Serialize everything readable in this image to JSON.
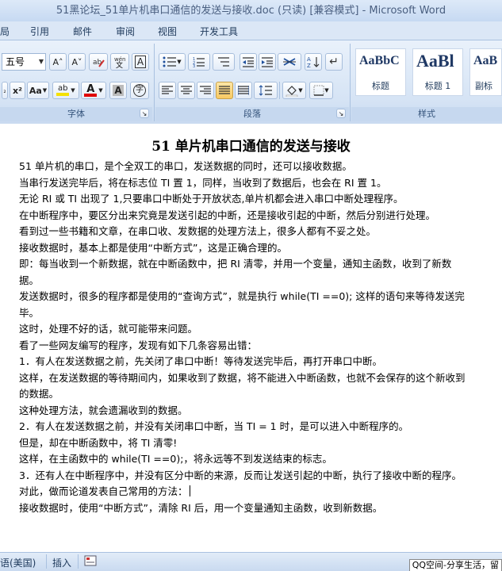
{
  "window": {
    "title": "51黑论坛_51单片机串口通信的发送与接收.doc (只读) [兼容模式] - Microsoft Word"
  },
  "menu": {
    "tabs": [
      "局",
      "引用",
      "邮件",
      "审阅",
      "视图",
      "开发工具"
    ]
  },
  "ribbon": {
    "font": {
      "size": "五号",
      "group_label": "字体",
      "grow_label": "A˄",
      "shrink_label": "A˅",
      "phonetic_label": "ab",
      "char_border_label": "A",
      "superscript_label": "x²",
      "case_label": "Aa",
      "highlight_label": "ab",
      "font_color_label": "A",
      "shading_label": "A",
      "enclose_label": "字",
      "highlight_color": "#f5e100",
      "font_color": "#e00000"
    },
    "paragraph": {
      "group_label": "段落"
    },
    "styles": {
      "group_label": "样式",
      "items": [
        {
          "sample": "AaBbC",
          "name": "标题"
        },
        {
          "sample": "AaBl",
          "name": "标题 1"
        },
        {
          "sample": "AaB",
          "name": "副标"
        }
      ]
    }
  },
  "document": {
    "title": "51 单片机串口通信的发送与接收",
    "paragraphs": [
      "51 单片机的串口，是个全双工的串口，发送数据的同时，还可以接收数据。",
      "当串行发送完毕后，将在标志位 TI 置 1，同样，当收到了数据后，也会在 RI 置 1。",
      "无论 RI 或 TI 出现了 1,只要串口中断处于开放状态,单片机都会进入串口中断处理程序。",
      "在中断程序中，要区分出来究竟是发送引起的中断，还是接收引起的中断，然后分别进行处理。",
      "看到过一些书籍和文章，在串口收、发数据的处理方法上，很多人都有不妥之处。",
      "接收数据时，基本上都是使用“中断方式”，这是正确合理的。",
      "即：每当收到一个新数据，就在中断函数中，把 RI 清零，并用一个变量，通知主函数，收到了新数据。",
      "发送数据时，很多的程序都是使用的“查询方式”，就是执行 while(TI ==0); 这样的语句来等待发送完毕。",
      "这时，处理不好的话，就可能带来问题。",
      "看了一些网友编写的程序，发现有如下几条容易出错：",
      "1．有人在发送数据之前，先关闭了串口中断！等待发送完毕后，再打开串口中断。",
      "这样，在发送数据的等待期间内，如果收到了数据，将不能进入中断函数，也就不会保存的这个新收到的数据。",
      "这种处理方法，就会遗漏收到的数据。",
      "2．有人在发送数据之前，并没有关闭串口中断，当 TI = 1 时，是可以进入中断程序的。",
      "但是，却在中断函数中，将 TI 清零!",
      "这样，在主函数中的 while(TI ==0);，将永远等不到发送结束的标志。",
      "3．还有人在中断程序中，并没有区分中断的来源，反而让发送引起的中断，执行了接收中断的程序。",
      "对此，做而论道发表自己常用的方法：",
      "接收数据时，使用“中断方式”，清除 RI 后，用一个变量通知主函数，收到新数据。"
    ]
  },
  "status": {
    "language": "语(美国)",
    "insert": "插入",
    "qq_text": "QQ空间-分享生活，留"
  }
}
